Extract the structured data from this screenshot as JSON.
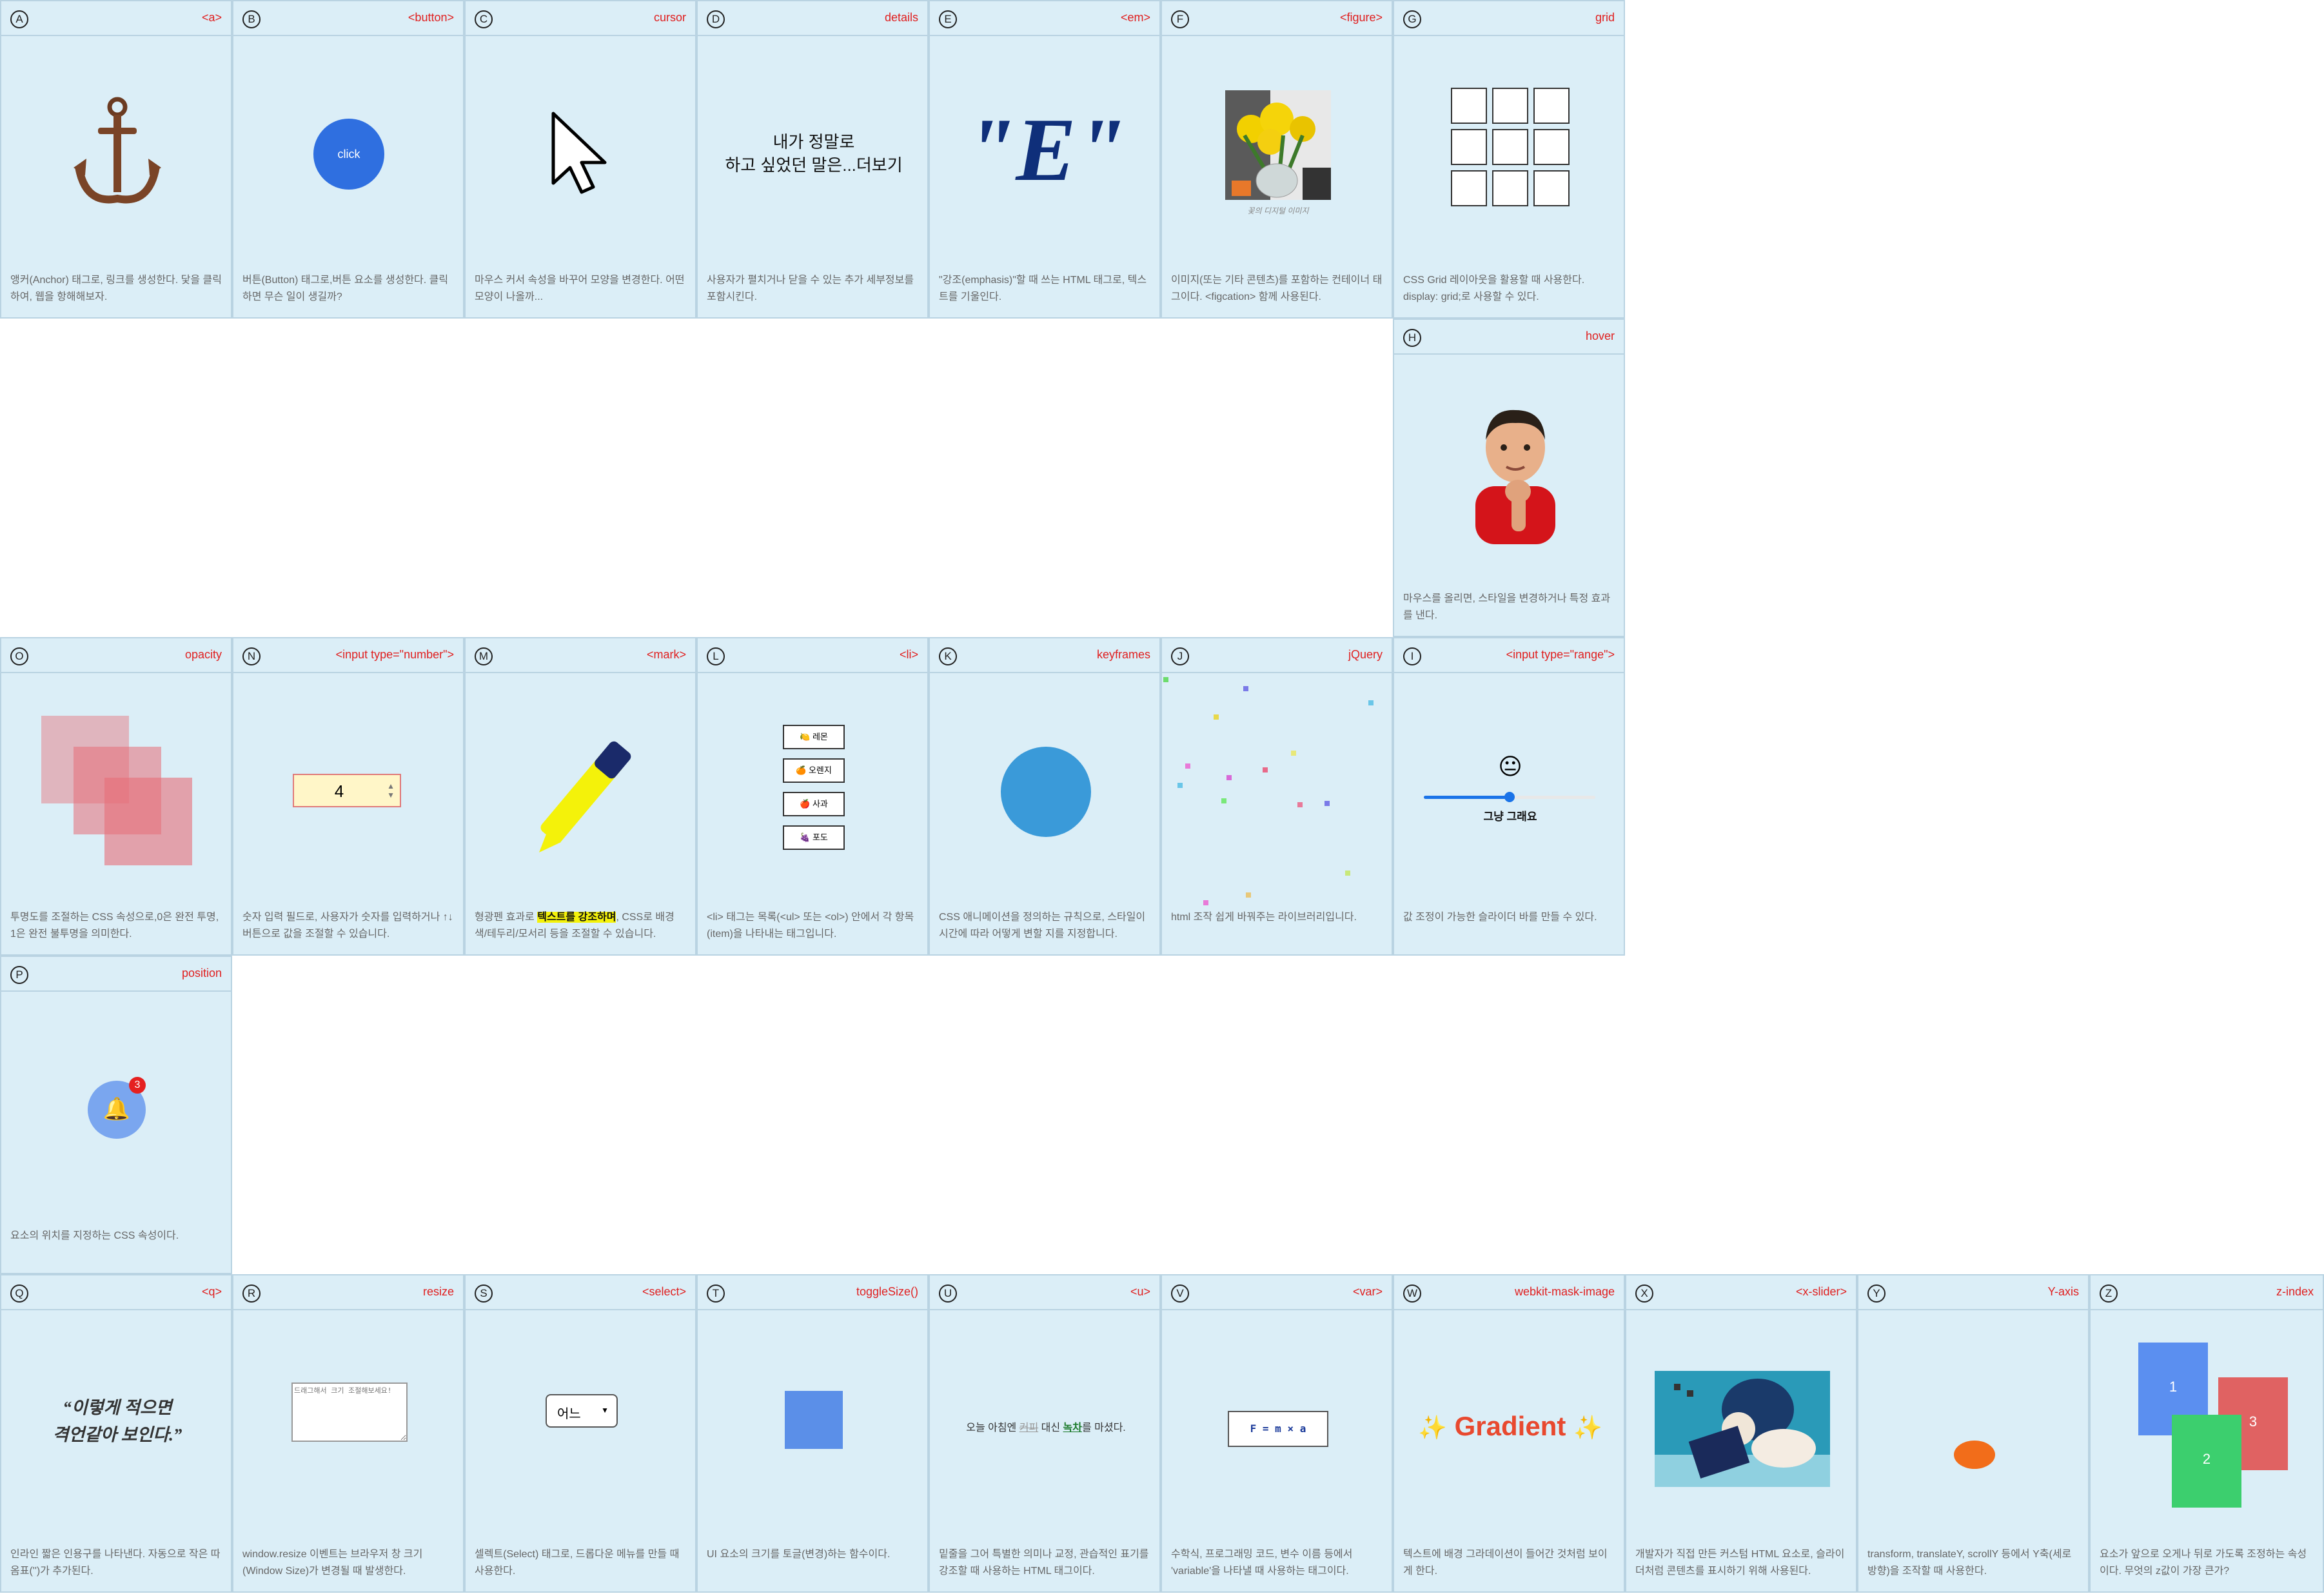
{
  "cards": {
    "A": {
      "letter": "A",
      "tag": "<a>",
      "desc": "앵커(Anchor) 태그로, 링크를 생성한다. 닻을 클릭하여, 웹을 항해해보자."
    },
    "B": {
      "letter": "B",
      "tag": "<button>",
      "desc": "버튼(Button) 태그로,버튼 요소를 생성한다. 클릭하면 무슨 일이 생길까?",
      "button_label": "click"
    },
    "C": {
      "letter": "C",
      "tag": "cursor",
      "desc": "마우스 커서 속성을 바꾸어 모양을 변경한다. 어떤 모양이 나올까..."
    },
    "D": {
      "letter": "D",
      "tag": "details",
      "desc": "사용자가 펼치거나 닫을 수 있는 추가 세부정보를 포함시킨다.",
      "line1": "내가 정말로",
      "line2": "하고 싶었던 말은...더보기"
    },
    "E": {
      "letter": "E",
      "tag": "<em>",
      "desc": "\"강조(emphasis)\"할 때 쓰는 HTML 태그로, 텍스트를 기울인다.",
      "big": "\"E\""
    },
    "F": {
      "letter": "F",
      "tag": "<figure>",
      "desc": "이미지(또는 기타 콘텐츠)를 포함하는 컨테이너 태그이다. <figcation> 함께 사용된다.",
      "caption": "꽃의 디지털 이미지"
    },
    "G": {
      "letter": "G",
      "tag": "grid",
      "desc": "CSS Grid 레이아웃을 활용할 때 사용한다. display: grid;로 사용할 수 있다."
    },
    "H": {
      "letter": "H",
      "tag": "hover",
      "desc": "마우스를 올리면, 스타일을 변경하거나 특정 효과를 낸다."
    },
    "O": {
      "letter": "O",
      "tag": "opacity",
      "desc": "투명도를 조절하는 CSS 속성으로,0은 완전 투명, 1은 완전 불투명을 의미한다."
    },
    "N": {
      "letter": "N",
      "tag": "<input type=\"number\">",
      "desc": "숫자 입력 필드로, 사용자가 숫자를 입력하거나 ↑↓ 버튼으로 값을 조절할 수 있습니다.",
      "value": "4"
    },
    "M": {
      "letter": "M",
      "tag": "<mark>",
      "desc_before": "형광펜 효과로 ",
      "desc_mark": "텍스트를 강조하며",
      "desc_after": ", CSS로 배경색/테두리/모서리 등을 조절할 수 있습니다."
    },
    "L": {
      "letter": "L",
      "tag": "<li>",
      "desc": "<li> 태그는 목록(<ul> 또는 <ol>) 안에서 각 항목(item)을 나타내는 태그입니다.",
      "items": [
        "🍋 레몬",
        "🍊 오렌지",
        "🍎 사과",
        "🍇 포도"
      ]
    },
    "K": {
      "letter": "K",
      "tag": "keyframes",
      "desc": "CSS 애니메이션을 정의하는 규칙으로, 스타일이 시간에 따라 어떻게 변할 지를 지정합니다."
    },
    "J": {
      "letter": "J",
      "tag": "jQuery",
      "desc": "html 조작 쉽게 바꿔주는 라이브러리입니다."
    },
    "I": {
      "letter": "I",
      "tag": "<input type=\"range\">",
      "desc": "값 조정이 가능한 슬라이더 바를 만들 수 있다.",
      "emoji": "😐",
      "label": "그냥 그래요",
      "value_fraction": 0.5
    },
    "P": {
      "letter": "P",
      "tag": "position",
      "desc": "요소의 위치를 지정하는 CSS 속성이다.",
      "badge": "3",
      "bell": "🔔"
    },
    "Q": {
      "letter": "Q",
      "tag": "<q>",
      "desc": "인라인 짧은 인용구를 나타낸다. 자동으로 작은 따옴표('')가 추가된다.",
      "line1": "“이렇게 적으면",
      "line2": "격언같아 보인다.”"
    },
    "R": {
      "letter": "R",
      "tag": "resize",
      "desc": "window.resize 이벤트는 브라우저 창 크기(Window Size)가 변경될 때 발생한다.",
      "placeholder": "드래그해서 크기 조절해보세요!"
    },
    "S": {
      "letter": "S",
      "tag": "<select>",
      "desc": "셀렉트(Select) 태그로, 드롭다운 메뉴를 만들 때 사용한다.",
      "selected": "어느"
    },
    "T": {
      "letter": "T",
      "tag": "toggleSize()",
      "desc": "UI 요소의 크기를 토글(변경)하는 함수이다."
    },
    "U": {
      "letter": "U",
      "tag": "<u>",
      "desc": "밑줄을 그어 특별한 의미나 교정, 관습적인 표기를 강조할 때 사용하는 HTML 태그이다.",
      "t1": "오늘 아침엔 ",
      "t2": "커피",
      "t3": " 대신 ",
      "t4": "녹차",
      "t5": "를 마셨다."
    },
    "V": {
      "letter": "V",
      "tag": "<var>",
      "desc": "수학식, 프로그래밍 코드, 변수 이름 등에서 'variable'을 나타낼 때 사용하는 태그이다.",
      "formula": "F = m × a"
    },
    "W": {
      "letter": "W",
      "tag": "webkit-mask-image",
      "desc": "텍스트에 배경 그라데이션이 들어간 것처럼 보이게 한다.",
      "spark1": "✨",
      "text": "Gradient",
      "spark2": "✨"
    },
    "X": {
      "letter": "X",
      "tag": "<x-slider>",
      "desc": "개발자가 직접 만든 커스텀 HTML 요소로, 슬라이더처럼 콘텐츠를 표시하기 위해 사용된다."
    },
    "Y": {
      "letter": "Y",
      "tag": "Y-axis",
      "desc": "transform, translateY, scrollY 등에서 Y축(세로 방향)을 조작할 때 사용한다."
    },
    "Z": {
      "letter": "Z",
      "tag": "z-index",
      "desc": "요소가 앞으로 오게나 뒤로 가도록 조정하는 속성이다. 무엇의 z값이 가장 큰가?",
      "boxes": [
        "1",
        "2",
        "3"
      ]
    }
  },
  "colors": {
    "card_bg": "#dbeef7",
    "tag": "#e02020",
    "button": "#2f6fe0",
    "em": "#0f2f7a",
    "mark": "#f4f20a",
    "keyframes_ball": "#3a9ad9",
    "toggle_box": "#5b8fe8",
    "y_axis_ball": "#f26d1a",
    "z_blue": "#5b8ff0",
    "z_green": "#3ccf6e",
    "z_red": "#e06262",
    "gradient_text": "#e8492f"
  }
}
